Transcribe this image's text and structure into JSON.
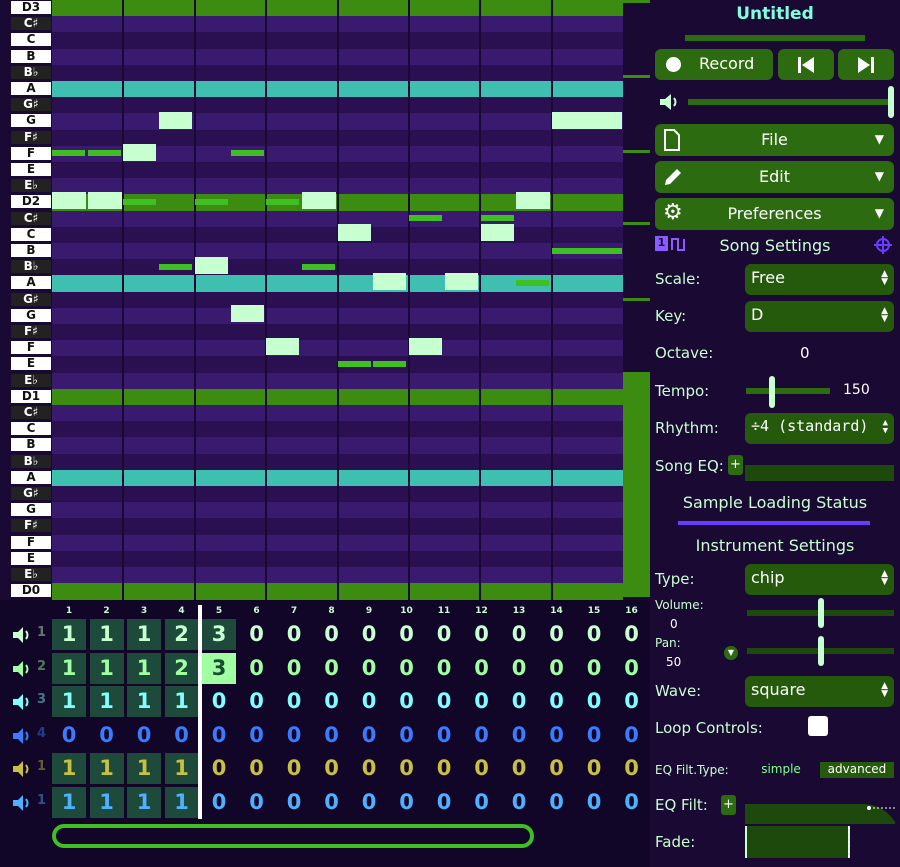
{
  "song": {
    "title": "Untitled"
  },
  "piano_keys": [
    "D3",
    "C♯",
    "C",
    "B",
    "B♭",
    "A",
    "G♯",
    "G",
    "F♯",
    "F",
    "E",
    "E♭",
    "D2",
    "C♯",
    "C",
    "B",
    "B♭",
    "A",
    "G♯",
    "G",
    "F♯",
    "F",
    "E",
    "E♭",
    "D1",
    "C♯",
    "C",
    "B",
    "B♭",
    "A",
    "G♯",
    "G",
    "F♯",
    "F",
    "E",
    "E♭",
    "D0"
  ],
  "transport": {
    "record_label": "Record",
    "play_icon": "skip-back-icon",
    "next_icon": "skip-forward-icon"
  },
  "menus": {
    "file": "File",
    "edit": "Edit",
    "preferences": "Preferences"
  },
  "song_settings": {
    "title": "Song Settings",
    "scale_label": "Scale:",
    "scale_value": "Free",
    "key_label": "Key:",
    "key_value": "D",
    "octave_label": "Octave:",
    "octave_value": "0",
    "tempo_label": "Tempo:",
    "tempo_value": "150",
    "rhythm_label": "Rhythm:",
    "rhythm_value": "÷4 (standard)",
    "eq_label": "Song EQ:",
    "eq_add": "+"
  },
  "sample_status": "Sample Loading Status",
  "instrument": {
    "title": "Instrument Settings",
    "type_label": "Type:",
    "type_value": "chip",
    "volume_label": "Volume:",
    "volume_value": "0",
    "pan_label": "Pan:",
    "pan_value": "50",
    "wave_label": "Wave:",
    "wave_value": "square",
    "loop_label": "Loop Controls:",
    "eqfilt_type_label": "EQ Filt.Type:",
    "eqfilt_simple": "simple",
    "eqfilt_advanced": "advanced",
    "eqfilt_label": "EQ Filt:",
    "eqfilt_add": "+",
    "fade_label": "Fade:"
  },
  "bar_numbers": [
    "1",
    "2",
    "3",
    "4",
    "5",
    "6",
    "7",
    "8",
    "9",
    "10",
    "11",
    "12",
    "13",
    "14",
    "15",
    "16"
  ],
  "channels": [
    {
      "index": "1",
      "color": "#c8ffd0",
      "patterns": [
        "1",
        "1",
        "1",
        "2",
        "3",
        "0",
        "0",
        "0",
        "0",
        "0",
        "0",
        "0",
        "0",
        "0",
        "0",
        "0"
      ]
    },
    {
      "index": "2",
      "color": "#a0ffa0",
      "patterns": [
        "1",
        "1",
        "1",
        "2",
        "3",
        "0",
        "0",
        "0",
        "0",
        "0",
        "0",
        "0",
        "0",
        "0",
        "0",
        "0"
      ]
    },
    {
      "index": "3",
      "color": "#7fffff",
      "patterns": [
        "1",
        "1",
        "1",
        "1",
        "0",
        "0",
        "0",
        "0",
        "0",
        "0",
        "0",
        "0",
        "0",
        "0",
        "0",
        "0"
      ]
    },
    {
      "index": "4",
      "color": "#3a7cff",
      "patterns": [
        "0",
        "0",
        "0",
        "0",
        "0",
        "0",
        "0",
        "0",
        "0",
        "0",
        "0",
        "0",
        "0",
        "0",
        "0",
        "0"
      ]
    },
    {
      "index": "1",
      "color": "#c8c040",
      "patterns": [
        "1",
        "1",
        "1",
        "1",
        "0",
        "0",
        "0",
        "0",
        "0",
        "0",
        "0",
        "0",
        "0",
        "0",
        "0",
        "0"
      ]
    },
    {
      "index": "1",
      "color": "#4fb0ff",
      "patterns": [
        "1",
        "1",
        "1",
        "1",
        "0",
        "0",
        "0",
        "0",
        "0",
        "0",
        "0",
        "0",
        "0",
        "0",
        "0",
        "0"
      ]
    }
  ]
}
